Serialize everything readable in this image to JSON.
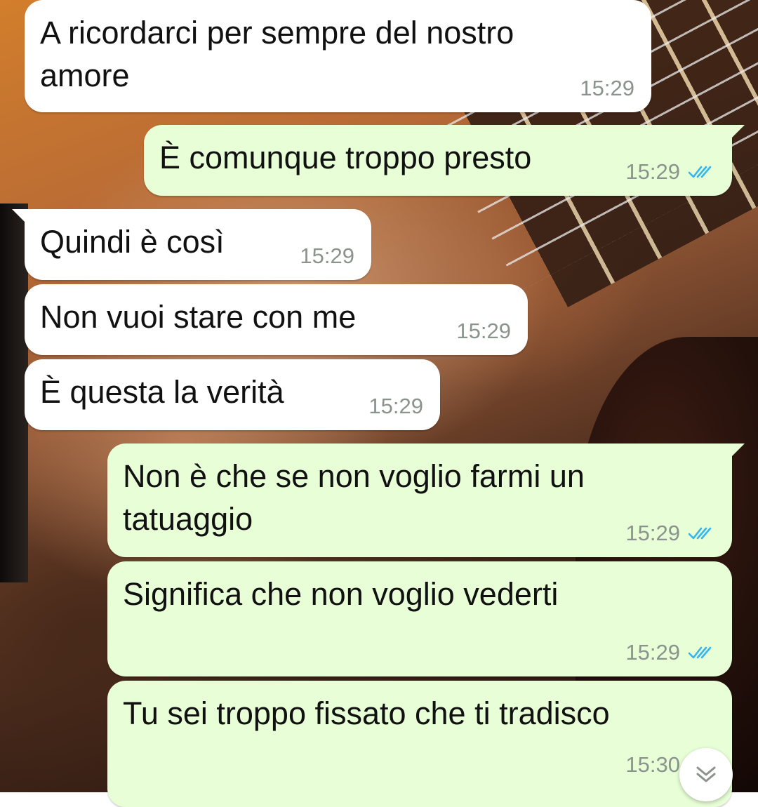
{
  "chat": {
    "messages": [
      {
        "id": "m1",
        "direction": "incoming",
        "text": "A ricordarci per sempre del nostro\namore",
        "time": "15:29"
      },
      {
        "id": "m2",
        "direction": "outgoing",
        "text": "È comunque troppo presto",
        "time": "15:29",
        "status": "read"
      },
      {
        "id": "m3",
        "direction": "incoming",
        "text": "Quindi è così",
        "time": "15:29"
      },
      {
        "id": "m4",
        "direction": "incoming",
        "text": "Non vuoi stare con me",
        "time": "15:29"
      },
      {
        "id": "m5",
        "direction": "incoming",
        "text": "È questa la verità",
        "time": "15:29"
      },
      {
        "id": "m6",
        "direction": "outgoing",
        "text": "Non è che se non voglio farmi un\ntatuaggio",
        "time": "15:29",
        "status": "read"
      },
      {
        "id": "m7",
        "direction": "outgoing",
        "text": "Significa che non voglio vederti",
        "time": "15:29",
        "status": "read"
      },
      {
        "id": "m8",
        "direction": "outgoing",
        "text": "Tu sei troppo fissato che ti tradisco",
        "time": "15:30",
        "status": "read"
      }
    ]
  },
  "colors": {
    "incoming_bubble": "#ffffff",
    "outgoing_bubble": "#e7fed6",
    "timestamp": "#8a948d",
    "read_ticks": "#34b7f1"
  },
  "icons": {
    "read_receipt": "double-check-icon",
    "scroll_down": "chevron-down-icon"
  }
}
